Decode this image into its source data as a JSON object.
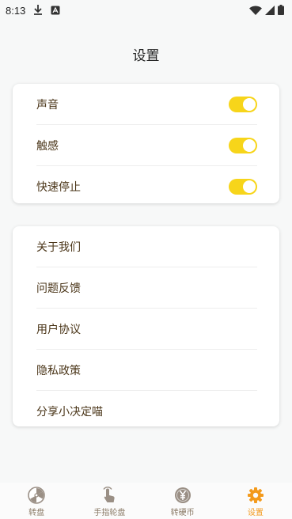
{
  "status_bar": {
    "time": "8:13"
  },
  "page": {
    "title": "设置"
  },
  "settings_card": {
    "items": [
      {
        "label": "声音",
        "on": true
      },
      {
        "label": "触感",
        "on": true
      },
      {
        "label": "快速停止",
        "on": true
      }
    ]
  },
  "info_card": {
    "items": [
      {
        "label": "关于我们"
      },
      {
        "label": "问题反馈"
      },
      {
        "label": "用户协议"
      },
      {
        "label": "隐私政策"
      },
      {
        "label": "分享小决定喵"
      }
    ]
  },
  "tab_bar": {
    "tabs": [
      {
        "label": "转盘",
        "icon": "wheel-icon"
      },
      {
        "label": "手指轮盘",
        "icon": "finger-icon"
      },
      {
        "label": "转硬币",
        "icon": "coin-icon"
      },
      {
        "label": "设置",
        "icon": "gear-icon",
        "active": true
      }
    ]
  },
  "colors": {
    "accent": "#f7d51a",
    "active_tab": "#f39a1c"
  }
}
